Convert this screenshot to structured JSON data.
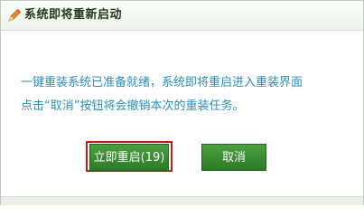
{
  "dialog": {
    "title": "系统即将重新启动",
    "title_icon": "pencil-icon",
    "message_line1": "一键重装系统已准备就绪，系统即将重启进入重装界面",
    "message_line2": "点击“取消”按钮将会撤销本次的重装任务。",
    "restart_button_label": "立即重启(19)",
    "cancel_button_label": "取消",
    "colors": {
      "accent_green": "#2c7a27",
      "message_text": "#2a8fb8",
      "highlight_red": "#d4141c"
    }
  }
}
